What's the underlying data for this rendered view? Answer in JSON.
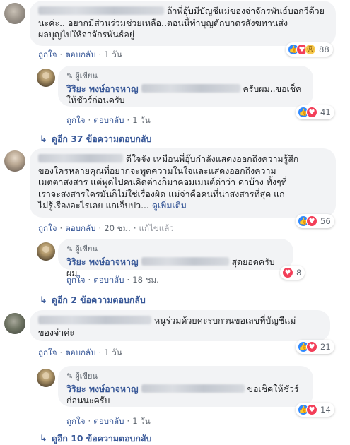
{
  "comments": [
    {
      "text": "ถ้าพี่อุ๊บมีบัญชีแม่ของจ่าจักรพันธ์บอกวีด้วยนะค่ะ.. อยากมีส่วนร่วมช่วยเหลือ..ตอนนี้ทำบุญตักบาตรสังฆทานส่งผลบุญไปให้จ่าจักรพันธ์อยู่",
      "line1": "ถ้าพี่อุ๊บมีบัญชีแม่ของจ่าจักรพันธ์บอกวีด้วย",
      "line2": "นะค่ะ.. อยากมีส่วนร่วมช่วยเหลือ..ตอนนี้ทำบุญตักบาตรสังฆทานส่ง",
      "line3": "ผลบุญไปให้จ่าจักรพันธ์อยู่",
      "like_label": "ถูกใจ",
      "reply_label": "ตอบกลับ",
      "time": "1 วัน",
      "reaction_count": "88",
      "reactions": [
        "like-icon",
        "love-icon",
        "sad-icon"
      ],
      "reply": {
        "badge": "ผู้เขียน",
        "author": "วิริยะ พงษ์อาจหาญ",
        "text_tail": "ครับผม..ขอเช็ค",
        "text_line2": "ให้ชัวร์ก่อนครับ",
        "like_label": "ถูกใจ",
        "reply_label": "ตอบกลับ",
        "time": "1 วัน",
        "reaction_count": "41",
        "reactions": [
          "like-icon",
          "love-icon"
        ]
      },
      "more_replies": "ดูอีก 37 ข้อความตอบกลับ"
    },
    {
      "line1": "ดีใจจัง เหมือนพี่อุ๊บกำลังแสดงออกถึงความรู้สึก",
      "line2": "ของใครหลายคุณที่อยากจะพูดความในใจและแสดงออกถึงความ",
      "line3": "เมตตาสงสาร แต่พูดไปคนคิดต่างก็มาคอมเมนต์ด่าว่า ด่าบ้าง ทั้งๆที่",
      "line4": "เราจะสงสารใครมันก็ไม่ใช่เรื่องผิด แม่จ่าคือคนที่น่าสงสารที่สุด แก",
      "line5": "ไม่รู้เรื่องอะไรเลย แกเจ็บปว...",
      "see_more": "ดูเพิ่มเติม",
      "like_label": "ถูกใจ",
      "reply_label": "ตอบกลับ",
      "time": "20 ชม.",
      "edited": "แก้ไขแล้ว",
      "reaction_count": "56",
      "reactions": [
        "like-icon",
        "love-icon"
      ],
      "reply": {
        "badge": "ผู้เขียน",
        "author": "วิริยะ พงษ์อาจหาญ",
        "text_tail": "สุดยอดครับผม",
        "like_label": "ถูกใจ",
        "reply_label": "ตอบกลับ",
        "time": "18 ชม.",
        "reaction_count": "8",
        "reactions": [
          "love-icon"
        ]
      },
      "more_replies": "ดูอีก 2 ข้อความตอบกลับ"
    },
    {
      "line1": "หนูร่วมด้วยค่ะรบกวนขอเลขที่บัญชีแม่",
      "line2": "ของจ่าค่ะ",
      "like_label": "ถูกใจ",
      "reply_label": "ตอบกลับ",
      "time": "1 วัน",
      "reaction_count": "21",
      "reactions": [
        "like-icon",
        "love-icon"
      ],
      "reply": {
        "badge": "ผู้เขียน",
        "author": "วิริยะ พงษ์อาจหาญ",
        "text_tail": "ขอเช็คให้ชัวร์",
        "text_line2": "ก่อนนะครับ",
        "like_label": "ถูกใจ",
        "reply_label": "ตอบกลับ",
        "time": "1 วัน",
        "reaction_count": "14",
        "reactions": [
          "like-icon",
          "love-icon"
        ]
      },
      "more_replies": "ดูอีก 10 ข้อความตอบกลับ"
    }
  ],
  "colors": {
    "link": "#385898",
    "bubble": "#f2f3f5",
    "like": "#2d88ff",
    "love": "#f33e58"
  }
}
